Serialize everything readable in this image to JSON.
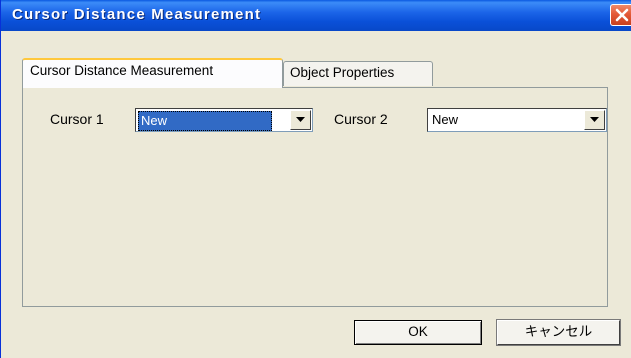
{
  "window": {
    "title": "Cursor Distance Measurement"
  },
  "tabs": [
    {
      "label": "Cursor Distance Measurement",
      "active": true
    },
    {
      "label": "Object Properties",
      "active": false
    }
  ],
  "cursor1": {
    "label": "Cursor 1",
    "value": "New",
    "focused": true
  },
  "cursor2": {
    "label": "Cursor 2",
    "value": "New",
    "focused": false
  },
  "buttons": {
    "ok": "OK",
    "cancel": "キャンセル"
  },
  "icons": {
    "close": "close-icon",
    "dropdown": "chevron-down-icon"
  },
  "colors": {
    "titlebar": "#0a50d8",
    "close": "#e45a38",
    "selection": "#316ac5",
    "face": "#ece9d8",
    "tab_highlight": "#ffc83c"
  }
}
